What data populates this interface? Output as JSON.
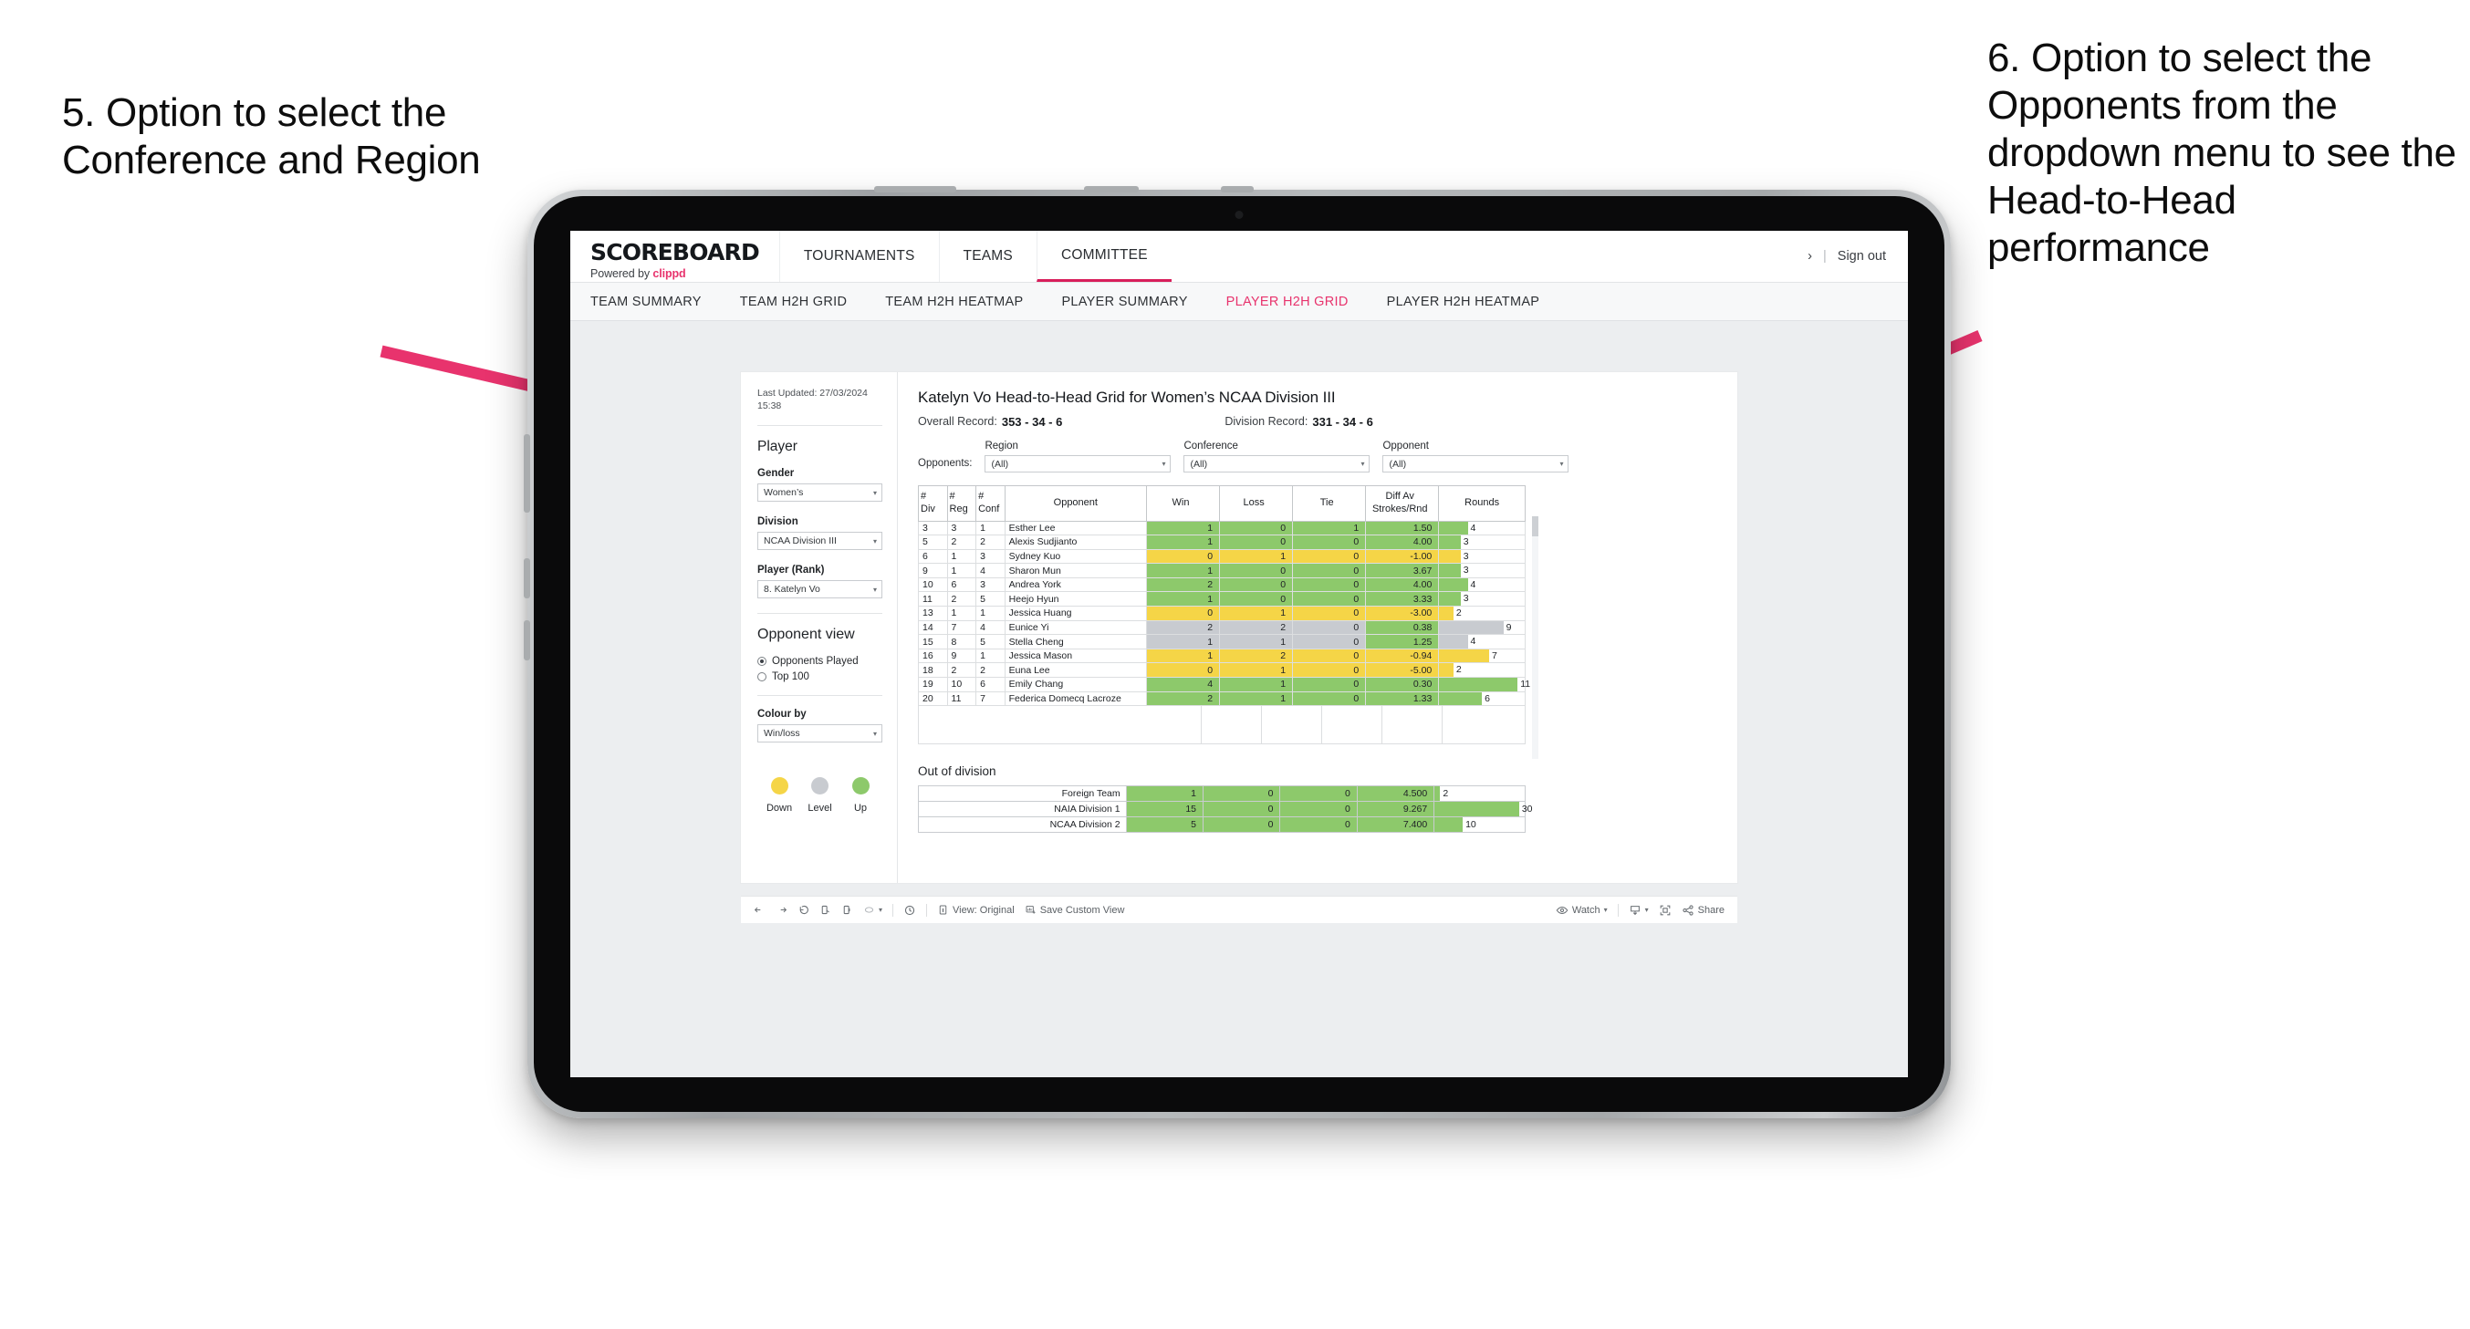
{
  "annotations": {
    "left": "5. Option to select the Conference and Region",
    "right": "6. Option to select the Opponents from the dropdown menu to see the Head-to-Head performance",
    "arrow_color": "#e8336d"
  },
  "topnav": {
    "brand_title": "SCOREBOARD",
    "brand_sub_prefix": "Powered by",
    "brand_sub_name": "clippd",
    "items": [
      {
        "label": "TOURNAMENTS",
        "active": false
      },
      {
        "label": "TEAMS",
        "active": false
      },
      {
        "label": "COMMITTEE",
        "active": true
      }
    ],
    "chevron": "›",
    "separator": "|",
    "sign_out": "Sign out"
  },
  "subnav": {
    "items": [
      {
        "label": "TEAM SUMMARY",
        "active": false
      },
      {
        "label": "TEAM H2H GRID",
        "active": false
      },
      {
        "label": "TEAM H2H HEATMAP",
        "active": false
      },
      {
        "label": "PLAYER SUMMARY",
        "active": false
      },
      {
        "label": "PLAYER H2H GRID",
        "active": true
      },
      {
        "label": "PLAYER H2H HEATMAP",
        "active": false
      }
    ],
    "active_color": "#e8336d"
  },
  "sidebar": {
    "last_updated": "Last Updated: 27/03/2024 15:38",
    "player_heading": "Player",
    "fields": [
      {
        "label": "Gender",
        "value": "Women’s"
      },
      {
        "label": "Division",
        "value": "NCAA Division III"
      },
      {
        "label": "Player (Rank)",
        "value": "8. Katelyn Vo"
      }
    ],
    "opponent_view_heading": "Opponent view",
    "opponent_view_options": [
      {
        "label": "Opponents Played",
        "selected": true
      },
      {
        "label": "Top 100",
        "selected": false
      }
    ],
    "colour_by_label": "Colour by",
    "colour_by_value": "Win/loss",
    "legend": [
      {
        "caption": "Down",
        "color": "#f5d547"
      },
      {
        "caption": "Level",
        "color": "#c8cbd0"
      },
      {
        "caption": "Up",
        "color": "#8dc96b"
      }
    ]
  },
  "main": {
    "title": "Katelyn Vo Head-to-Head Grid for Women’s NCAA Division III",
    "overall_record_label": "Overall Record:",
    "overall_record_value": "353 - 34 - 6",
    "division_record_label": "Division Record:",
    "division_record_value": "331 - 34 - 6",
    "opponents_label": "Opponents:",
    "filters": [
      {
        "label": "Region",
        "value": "(All)"
      },
      {
        "label": "Conference",
        "value": "(All)"
      },
      {
        "label": "Opponent",
        "value": "(All)"
      }
    ]
  },
  "chart_data": {
    "type": "table",
    "title": "Katelyn Vo Head-to-Head Grid for Women’s NCAA Division III",
    "columns": [
      "# Div",
      "# Reg",
      "# Conf",
      "Opponent",
      "Win",
      "Loss",
      "Tie",
      "Diff Av Strokes/Rnd",
      "Rounds"
    ],
    "header_lines": {
      "div": [
        "#",
        "Div"
      ],
      "reg": [
        "#",
        "Reg"
      ],
      "conf": [
        "#",
        "Conf"
      ],
      "opponent": [
        "Opponent"
      ],
      "win": [
        "Win"
      ],
      "loss": [
        "Loss"
      ],
      "tie": [
        "Tie"
      ],
      "diff": [
        "Diff Av",
        "Strokes/Rnd"
      ],
      "rounds": [
        "Rounds"
      ]
    },
    "rounds_max": 12,
    "rows": [
      {
        "div": "3",
        "reg": "3",
        "conf": "1",
        "opponent": "Esther Lee",
        "win": "1",
        "loss": "0",
        "tie": "1",
        "diff": "1.50",
        "rounds": "4",
        "state": "up"
      },
      {
        "div": "5",
        "reg": "2",
        "conf": "2",
        "opponent": "Alexis Sudjianto",
        "win": "1",
        "loss": "0",
        "tie": "0",
        "diff": "4.00",
        "rounds": "3",
        "state": "up"
      },
      {
        "div": "6",
        "reg": "1",
        "conf": "3",
        "opponent": "Sydney Kuo",
        "win": "0",
        "loss": "1",
        "tie": "0",
        "diff": "-1.00",
        "rounds": "3",
        "state": "down"
      },
      {
        "div": "9",
        "reg": "1",
        "conf": "4",
        "opponent": "Sharon Mun",
        "win": "1",
        "loss": "0",
        "tie": "0",
        "diff": "3.67",
        "rounds": "3",
        "state": "up"
      },
      {
        "div": "10",
        "reg": "6",
        "conf": "3",
        "opponent": "Andrea York",
        "win": "2",
        "loss": "0",
        "tie": "0",
        "diff": "4.00",
        "rounds": "4",
        "state": "up"
      },
      {
        "div": "11",
        "reg": "2",
        "conf": "5",
        "opponent": "Heejo Hyun",
        "win": "1",
        "loss": "0",
        "tie": "0",
        "diff": "3.33",
        "rounds": "3",
        "state": "up"
      },
      {
        "div": "13",
        "reg": "1",
        "conf": "1",
        "opponent": "Jessica Huang",
        "win": "0",
        "loss": "1",
        "tie": "0",
        "diff": "-3.00",
        "rounds": "2",
        "state": "down"
      },
      {
        "div": "14",
        "reg": "7",
        "conf": "4",
        "opponent": "Eunice Yi",
        "win": "2",
        "loss": "2",
        "tie": "0",
        "diff": "0.38",
        "rounds": "9",
        "state": "level",
        "diff_state": "up"
      },
      {
        "div": "15",
        "reg": "8",
        "conf": "5",
        "opponent": "Stella Cheng",
        "win": "1",
        "loss": "1",
        "tie": "0",
        "diff": "1.25",
        "rounds": "4",
        "state": "level",
        "diff_state": "up"
      },
      {
        "div": "16",
        "reg": "9",
        "conf": "1",
        "opponent": "Jessica Mason",
        "win": "1",
        "loss": "2",
        "tie": "0",
        "diff": "-0.94",
        "rounds": "7",
        "state": "down"
      },
      {
        "div": "18",
        "reg": "2",
        "conf": "2",
        "opponent": "Euna Lee",
        "win": "0",
        "loss": "1",
        "tie": "0",
        "diff": "-5.00",
        "rounds": "2",
        "state": "down"
      },
      {
        "div": "19",
        "reg": "10",
        "conf": "6",
        "opponent": "Emily Chang",
        "win": "4",
        "loss": "1",
        "tie": "0",
        "diff": "0.30",
        "rounds": "11",
        "state": "up"
      },
      {
        "div": "20",
        "reg": "11",
        "conf": "7",
        "opponent": "Federica Domecq Lacroze",
        "win": "2",
        "loss": "1",
        "tie": "0",
        "diff": "1.33",
        "rounds": "6",
        "state": "up"
      }
    ]
  },
  "out_of_division": {
    "heading": "Out of division",
    "rounds_max": 32,
    "rows": [
      {
        "name": "Foreign Team",
        "win": "1",
        "loss": "0",
        "tie": "0",
        "diff": "4.500",
        "rounds": "2",
        "state": "up"
      },
      {
        "name": "NAIA Division 1",
        "win": "15",
        "loss": "0",
        "tie": "0",
        "diff": "9.267",
        "rounds": "30",
        "state": "up"
      },
      {
        "name": "NCAA Division 2",
        "win": "5",
        "loss": "0",
        "tie": "0",
        "diff": "7.400",
        "rounds": "10",
        "state": "up"
      }
    ]
  },
  "toolbar": {
    "view_label": "View: Original",
    "save_label": "Save Custom View",
    "watch_label": "Watch",
    "share_label": "Share",
    "caret": "▾"
  }
}
